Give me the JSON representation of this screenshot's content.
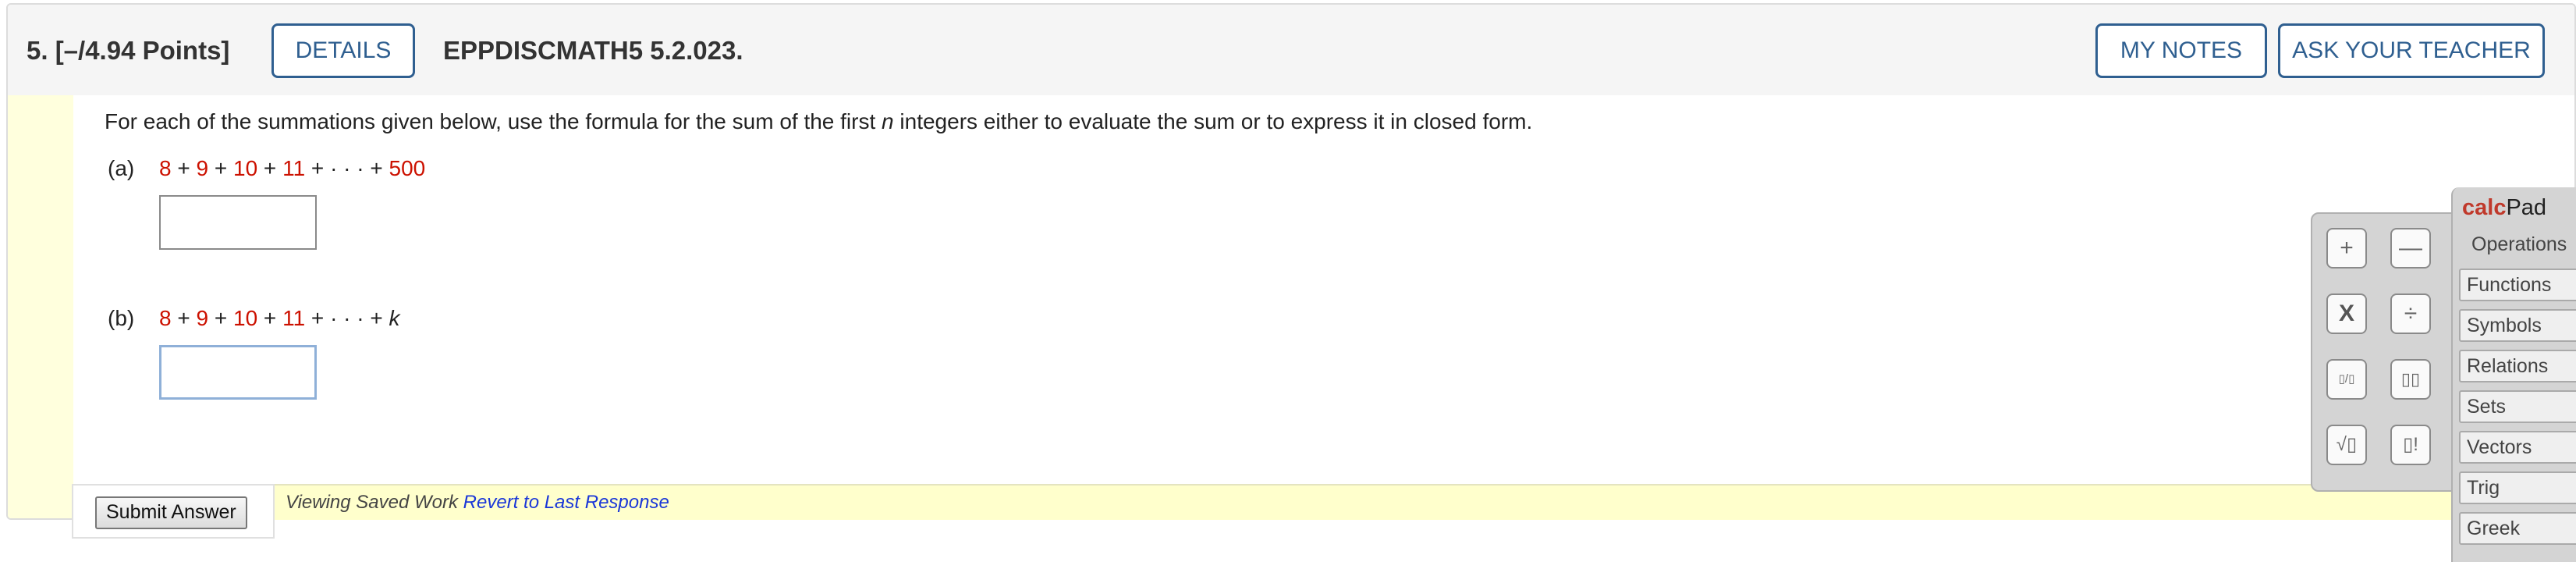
{
  "header": {
    "question": "5.  [–/4.94 Points]",
    "details_label": "DETAILS",
    "code": "EPPDISCMATH5 5.2.023.",
    "my_notes_label": "MY NOTES",
    "ask_teacher_label": "ASK YOUR TEACHER"
  },
  "question": {
    "prompt_before": "For each of the summations given below, use the formula for the sum of the first ",
    "prompt_var": "n",
    "prompt_after": " integers either to evaluate the sum or to express it in closed form.",
    "parts": [
      {
        "label": "(a)",
        "t1": "8",
        "op1": " + ",
        "t2": "9",
        "op2": " + ",
        "t3": "10",
        "op3": " + ",
        "t4": "11",
        "dots": " + · · · + ",
        "last": "500",
        "answer": ""
      },
      {
        "label": "(b)",
        "t1": "8",
        "op1": " + ",
        "t2": "9",
        "op2": " + ",
        "t3": "10",
        "op3": " + ",
        "t4": "11",
        "dots": " + · · · + ",
        "last": "k",
        "answer": ""
      }
    ]
  },
  "footer": {
    "submit_label": "Submit Answer",
    "saved_text": "Viewing Saved Work ",
    "revert_link": "Revert to Last Response"
  },
  "calcpad": {
    "title_bold": "calc",
    "title_rest": "Pad",
    "buttons": [
      {
        "icon": "plus-icon",
        "glyph": "+"
      },
      {
        "icon": "minus-icon",
        "glyph": "—"
      },
      {
        "icon": "times-icon",
        "glyph": "X"
      },
      {
        "icon": "divide-icon",
        "glyph": "÷"
      },
      {
        "icon": "fraction-icon",
        "glyph": "▯/▯"
      },
      {
        "icon": "exponent-icon",
        "glyph": "▯▯"
      },
      {
        "icon": "sqrt-icon",
        "glyph": "√▯"
      },
      {
        "icon": "factorial-icon",
        "glyph": "▯!"
      }
    ],
    "tabs": [
      "Operations",
      "Functions",
      "Symbols",
      "Relations",
      "Sets",
      "Vectors",
      "Trig",
      "Greek"
    ]
  },
  "colors": {
    "accent_blue": "#2f5f90",
    "term_red": "#cc1100",
    "link_blue": "#1a37d8",
    "highlight_yellow": "#ffffcc"
  }
}
